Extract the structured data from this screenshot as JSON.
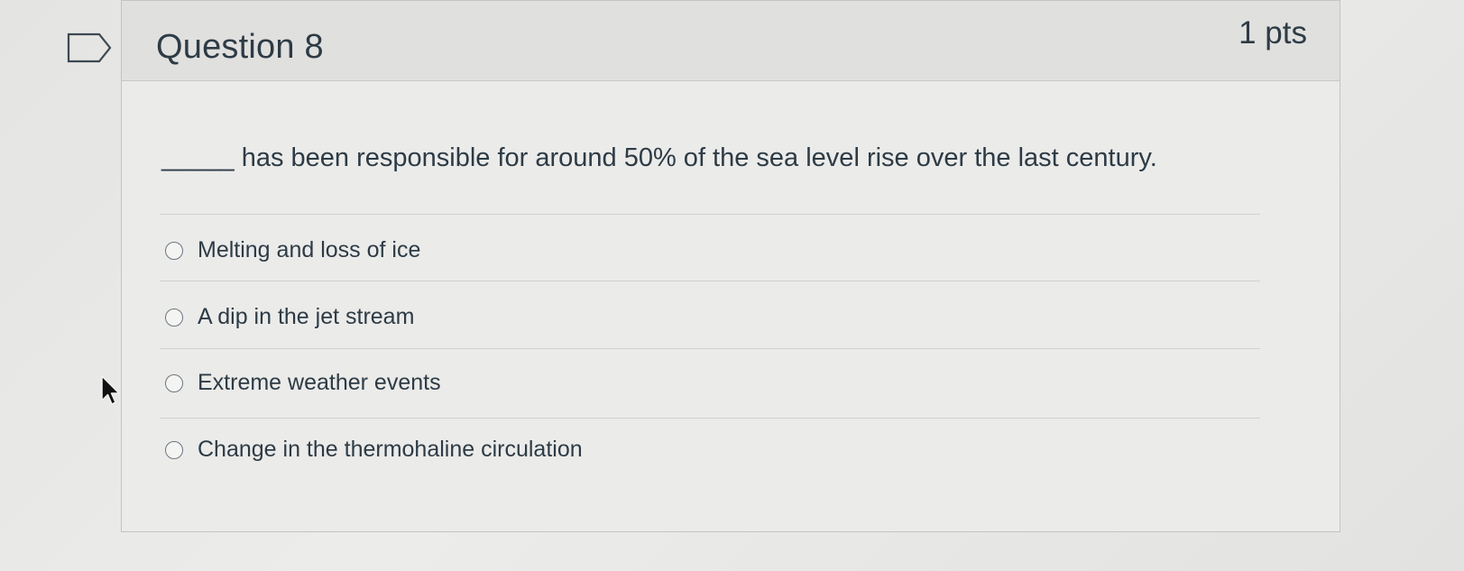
{
  "question": {
    "title": "Question 8",
    "points": "1 pts",
    "text": "_____ has been responsible for around 50% of the sea level rise over the last century."
  },
  "answers": [
    {
      "label": "Melting and loss of ice",
      "selected": false
    },
    {
      "label": "A dip in the jet stream",
      "selected": false
    },
    {
      "label": "Extreme weather events",
      "selected": false
    },
    {
      "label": "Change in the thermohaline circulation",
      "selected": false
    }
  ],
  "icons": {
    "flag": "flag-bookmark-icon",
    "cursor": "mouse-pointer-icon"
  },
  "colors": {
    "text": "#2d3b45",
    "border": "#c2c4c4",
    "header_background": "#e0e0df"
  }
}
